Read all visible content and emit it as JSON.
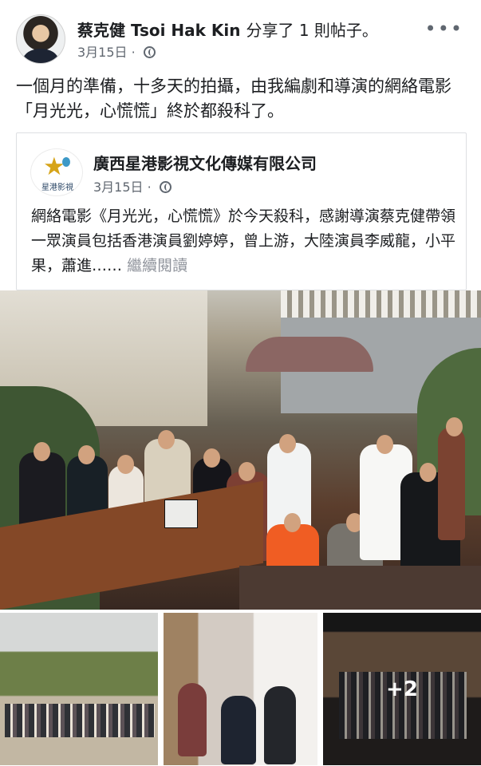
{
  "author": {
    "name": "蔡克健 Tsoi Hak Kin",
    "action": "分享了 1 則帖子。",
    "date": "3月15日 · "
  },
  "post_text": "一個月的準備，十多天的拍攝，由我編劇和導演的網絡電影「月光光，心慌慌」終於都殺科了。",
  "shared_post": {
    "logo_text": "星港影視",
    "org_name": "廣西星港影視文化傳媒有限公司",
    "date": "3月15日 · ",
    "text": "網絡電影《月光光，心慌慌》於今天殺科，感謝導演蔡克健帶領一眾演員包括香港演員劉婷婷，曾上游，大陸演員李威龍，小平果，蕭進……",
    "read_more": "繼續閱讀"
  },
  "photo_count": "+2",
  "icons": {
    "more": "more-icon",
    "privacy": "globe-icon",
    "logo": "star-logo"
  },
  "colors": {
    "author_text": "#1c1e21",
    "meta_text": "#606770",
    "border": "#dddfe2"
  }
}
